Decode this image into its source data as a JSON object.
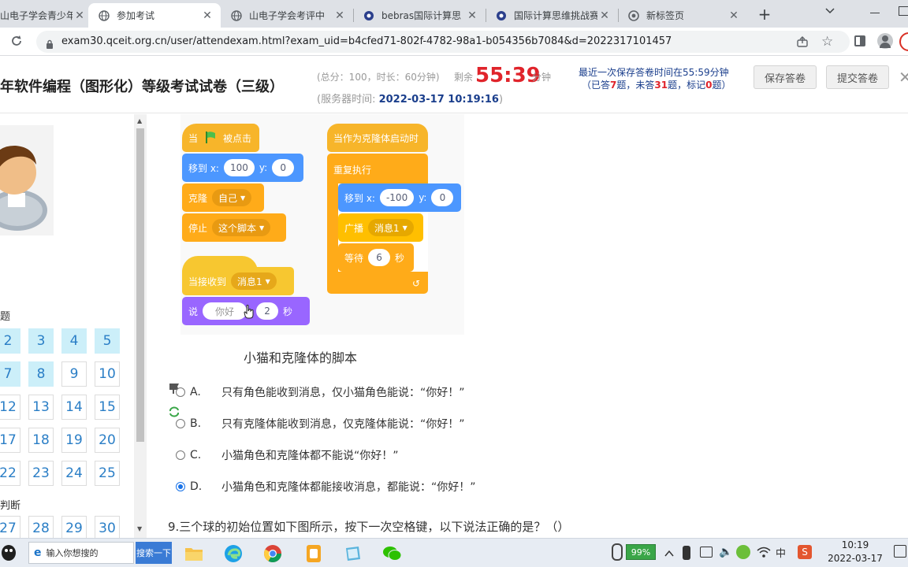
{
  "browser": {
    "tabs": [
      {
        "title": "山电子学会青少年"
      },
      {
        "title": "参加考试"
      },
      {
        "title": "山电子学会考评中"
      },
      {
        "title": "bebras国际计算思"
      },
      {
        "title": "国际计算思维挑战赛"
      },
      {
        "title": "新标签页"
      }
    ],
    "url": "exam30.qceit.org.cn/user/attendexam.html?exam_uid=b4cfed71-802f-4782-98a1-b054356b7084&d=2022317101457"
  },
  "header": {
    "title": "年软件编程（图形化）等级考试试卷（三级）",
    "meta": "(总分：100，时长：60分钟)",
    "remaining_label": "剩余",
    "remaining_time": "55:39",
    "remaining_unit": "分钟",
    "server_label": "(服务器时间:",
    "server_time": "2022-03-17 10:19:16",
    "server_close": ")",
    "save_status": "最近一次保存答卷时间在55:59分钟",
    "progress_prefix": "（已答",
    "answered": "7",
    "progress_mid1": "题，未答",
    "unanswered": "31",
    "progress_mid2": "题，标记",
    "marked": "0",
    "progress_suffix": "题）",
    "save_button": "保存答卷",
    "submit_button": "提交答卷"
  },
  "sidebar": {
    "section1": "题",
    "section2": "判断",
    "row1": [
      "2",
      "3",
      "4",
      "5"
    ],
    "row2": [
      "7",
      "8",
      "9",
      "10"
    ],
    "row3": [
      "12",
      "13",
      "14",
      "15"
    ],
    "row4": [
      "17",
      "18",
      "19",
      "20"
    ],
    "row5": [
      "22",
      "23",
      "24",
      "25"
    ],
    "row6": [
      "27",
      "28",
      "29",
      "30"
    ]
  },
  "scratch": {
    "flag_a": "当",
    "flag_b": "被点击",
    "goto1_a": "移到 x:",
    "goto1_x": "100",
    "goto1_b": "y:",
    "goto1_y": "0",
    "clone_label": "克隆",
    "clone_dd": "自己",
    "stop_label": "停止",
    "stop_dd": "这个脚本",
    "recv_label": "当接收到",
    "recv_dd": "消息1",
    "say_label": "说",
    "say_text": "你好",
    "say_secs": "2",
    "say_unit": "秒",
    "clonestart": "当作为克隆体启动时",
    "forever": "重复执行",
    "goto2_a": "移到 x:",
    "goto2_x": "-100",
    "goto2_b": "y:",
    "goto2_y": "0",
    "bcast_label": "广播",
    "bcast_dd": "消息1",
    "wait_label": "等待",
    "wait_secs": "6",
    "wait_unit": "秒"
  },
  "question": {
    "caption": "小猫和克隆体的脚本",
    "options": [
      {
        "letter": "A.",
        "text": "只有角色能收到消息，仅小猫角色能说：“你好！”"
      },
      {
        "letter": "B.",
        "text": "只有克隆体能收到消息，仅克隆体能说：“你好！”"
      },
      {
        "letter": "C.",
        "text": "小猫角色和克隆体都不能说“你好！”"
      },
      {
        "letter": "D.",
        "text": "小猫角色和克隆体都能接收消息，都能说：“你好！”"
      }
    ],
    "next_question": "9.三个球的初始位置如下图所示，按下一次空格键，以下说法正确的是？（）"
  },
  "taskbar": {
    "search_text": "输入你想搜的",
    "search_button": "搜索一下",
    "battery": "99%",
    "ime": "中",
    "time": "10:19",
    "date": "2022-03-17"
  }
}
